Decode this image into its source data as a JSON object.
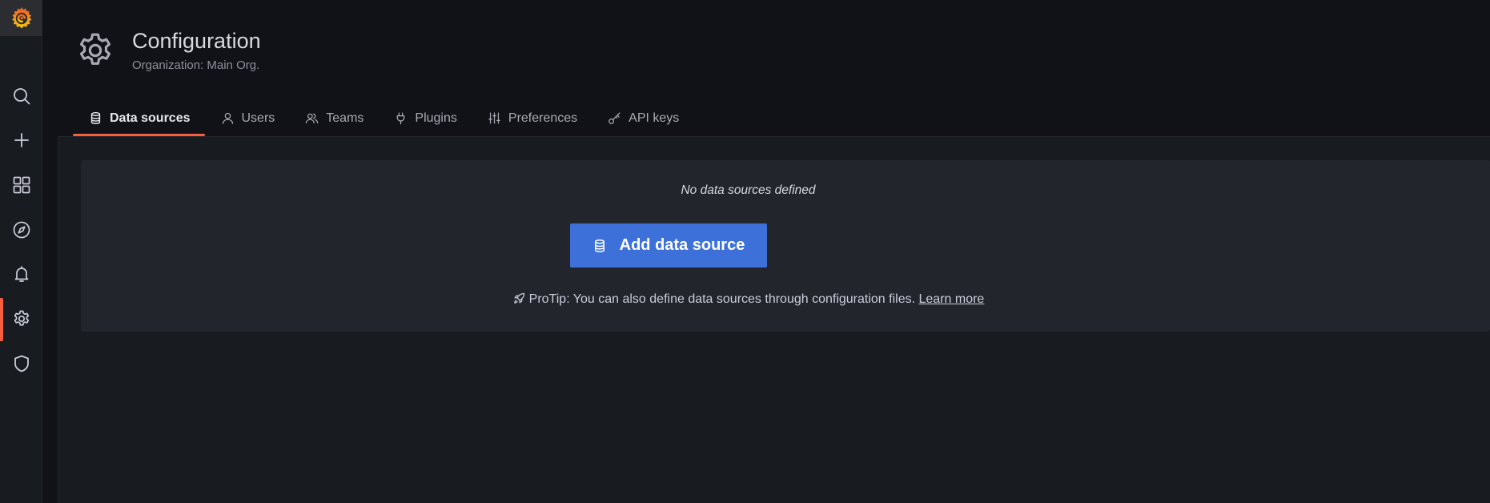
{
  "sidebar": {
    "logo_icon": "grafana-logo-icon",
    "items": [
      {
        "icon": "search-icon"
      },
      {
        "icon": "plus-icon"
      },
      {
        "icon": "dashboards-grid-icon"
      },
      {
        "icon": "explore-compass-icon"
      },
      {
        "icon": "alerting-bell-icon"
      },
      {
        "icon": "configuration-gear-icon",
        "active": true
      },
      {
        "icon": "server-admin-shield-icon"
      }
    ],
    "active_color": "#f55f3e"
  },
  "header": {
    "title": "Configuration",
    "subtitle": "Organization: Main Org.",
    "icon": "gear-icon"
  },
  "tabs": [
    {
      "label": "Data sources",
      "icon": "database-icon",
      "active": true
    },
    {
      "label": "Users",
      "icon": "user-icon"
    },
    {
      "label": "Teams",
      "icon": "users-group-icon"
    },
    {
      "label": "Plugins",
      "icon": "plug-icon"
    },
    {
      "label": "Preferences",
      "icon": "sliders-icon"
    },
    {
      "label": "API keys",
      "icon": "key-icon"
    }
  ],
  "empty_state": {
    "message": "No data sources defined",
    "button_label": "Add data source",
    "button_icon": "database-icon",
    "protip_text": "ProTip: You can also define data sources through configuration files.",
    "protip_icon": "rocket-icon",
    "learn_more_label": "Learn more"
  },
  "colors": {
    "accent": "#f55f3e",
    "primary_button": "#3d71d9",
    "background": "#111217",
    "panel": "#22252b"
  }
}
